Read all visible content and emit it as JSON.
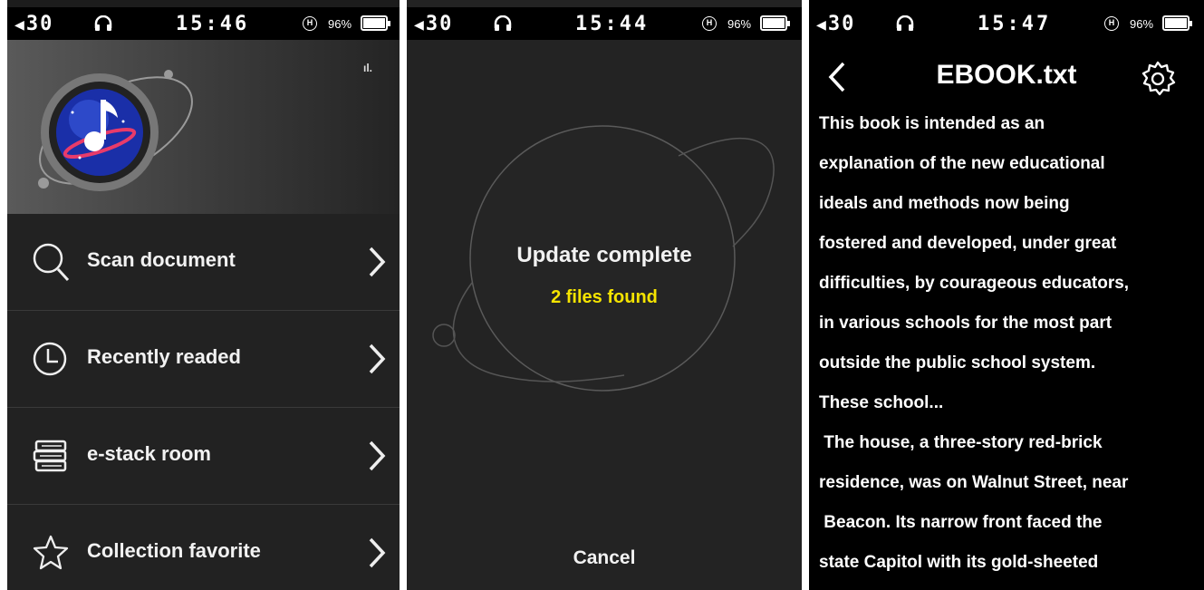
{
  "status_bars": [
    {
      "volume": "30",
      "time": "15:46",
      "hold": "H",
      "battery": "96%"
    },
    {
      "volume": "30",
      "time": "15:44",
      "hold": "H",
      "battery": "96%"
    },
    {
      "volume": "30",
      "time": "15:47",
      "hold": "H",
      "battery": "96%"
    }
  ],
  "home": {
    "menu": [
      {
        "label": "Scan document",
        "icon": "search-icon"
      },
      {
        "label": "Recently readed",
        "icon": "clock-icon"
      },
      {
        "label": "e-stack room",
        "icon": "book-stack-icon"
      },
      {
        "label": "Collection favorite",
        "icon": "star-icon"
      }
    ]
  },
  "scan": {
    "title": "Update complete",
    "subtitle": "2 files found",
    "cancel": "Cancel",
    "accent": "#f5e400"
  },
  "reader": {
    "title": "EBOOK.txt",
    "lines": [
      "This book is intended as an",
      "explanation of the new educational",
      "ideals and methods now being",
      "fostered and developed, under great",
      "difficulties, by courageous educators,",
      "in various schools for the most part",
      "outside the public school system.",
      "These school...",
      " The house, a three-story red-brick",
      "residence, was on Walnut Street, near",
      " Beacon. Its narrow front faced the",
      "state Capitol with its gold-sheeted"
    ]
  }
}
